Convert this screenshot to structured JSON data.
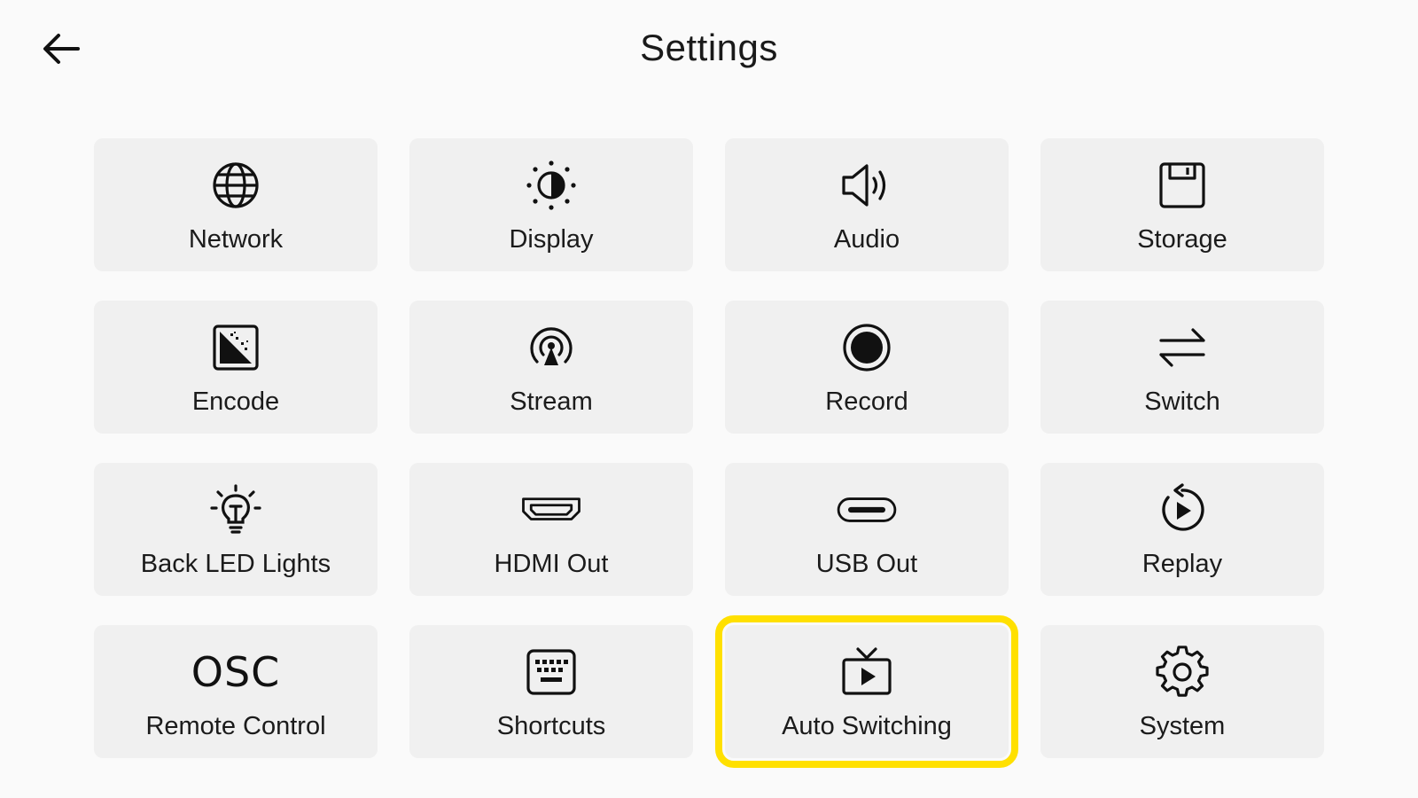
{
  "header": {
    "title": "Settings",
    "back_icon": "arrow-left-icon"
  },
  "tiles": [
    {
      "label": "Network",
      "icon": "globe-icon"
    },
    {
      "label": "Display",
      "icon": "brightness-icon"
    },
    {
      "label": "Audio",
      "icon": "speaker-icon"
    },
    {
      "label": "Storage",
      "icon": "floppy-disk-icon"
    },
    {
      "label": "Encode",
      "icon": "gradient-square-icon"
    },
    {
      "label": "Stream",
      "icon": "broadcast-icon"
    },
    {
      "label": "Record",
      "icon": "record-icon"
    },
    {
      "label": "Switch",
      "icon": "swap-arrows-icon"
    },
    {
      "label": "Back LED Lights",
      "icon": "bulb-icon"
    },
    {
      "label": "HDMI Out",
      "icon": "hdmi-port-icon"
    },
    {
      "label": "USB Out",
      "icon": "usb-c-port-icon"
    },
    {
      "label": "Replay",
      "icon": "replay-icon"
    },
    {
      "label": "Remote Control",
      "icon_text": "OSC"
    },
    {
      "label": "Shortcuts",
      "icon": "keyboard-icon"
    },
    {
      "label": "Auto Switching",
      "icon": "tv-play-icon",
      "selected": true
    },
    {
      "label": "System",
      "icon": "gear-icon"
    }
  ],
  "colors": {
    "background": "#fafafa",
    "tile": "#f0f0f0",
    "highlight": "#ffe000"
  }
}
